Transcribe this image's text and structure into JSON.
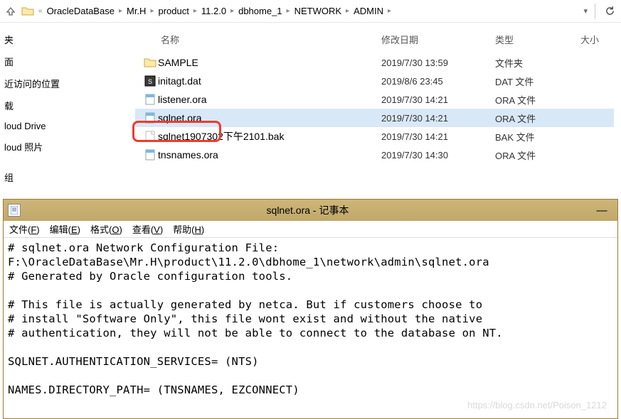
{
  "breadcrumbs": [
    "OracleDataBase",
    "Mr.H",
    "product",
    "11.2.0",
    "dbhome_1",
    "NETWORK",
    "ADMIN"
  ],
  "columns": {
    "name": "名称",
    "date": "修改日期",
    "type": "类型",
    "size": "大小"
  },
  "sidebar": {
    "items": [
      "夹",
      "面",
      "近访问的位置",
      "载",
      "loud Drive",
      "loud 照片",
      "组"
    ]
  },
  "files": [
    {
      "icon": "folder",
      "name": "SAMPLE",
      "date": "2019/7/30 13:59",
      "type": "文件夹"
    },
    {
      "icon": "dat",
      "name": "initagt.dat",
      "date": "2019/8/6 23:45",
      "type": "DAT 文件"
    },
    {
      "icon": "ora",
      "name": "listener.ora",
      "date": "2019/7/30 14:21",
      "type": "ORA 文件"
    },
    {
      "icon": "ora",
      "name": "sqlnet.ora",
      "date": "2019/7/30 14:21",
      "type": "ORA 文件",
      "selected": true
    },
    {
      "icon": "bak",
      "name": "sqlnet1907302下午2101.bak",
      "date": "2019/7/30 14:21",
      "type": "BAK 文件"
    },
    {
      "icon": "ora",
      "name": "tnsnames.ora",
      "date": "2019/7/30 14:30",
      "type": "ORA 文件"
    }
  ],
  "notepad": {
    "title": "sqlnet.ora - 记事本",
    "menu": {
      "file": "文件(F)",
      "edit": "编辑(E)",
      "format": "格式(O)",
      "view": "查看(V)",
      "help": "帮助(H)"
    },
    "content": "# sqlnet.ora Network Configuration File: F:\\OracleDataBase\\Mr.H\\product\\11.2.0\\dbhome_1\\network\\admin\\sqlnet.ora\n# Generated by Oracle configuration tools.\n\n# This file is actually generated by netca. But if customers choose to\n# install \"Software Only\", this file wont exist and without the native\n# authentication, they will not be able to connect to the database on NT.\n\nSQLNET.AUTHENTICATION_SERVICES= (NTS)\n\nNAMES.DIRECTORY_PATH= (TNSNAMES, EZCONNECT)\n"
  },
  "watermark": "https://blog.csdn.net/Poison_1212"
}
